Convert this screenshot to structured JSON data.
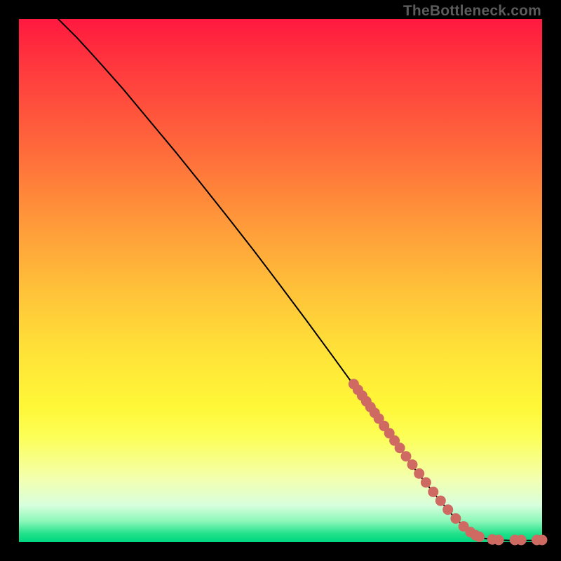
{
  "watermark": "TheBottleneck.com",
  "colors": {
    "dot_fill": "#cf6a63",
    "curve_stroke": "#000000"
  },
  "chart_data": {
    "type": "line",
    "title": "",
    "xlabel": "",
    "ylabel": "",
    "xlim": [
      0,
      100
    ],
    "ylim": [
      0,
      100
    ],
    "curve": [
      {
        "x": 7.5,
        "y": 100.0
      },
      {
        "x": 9.0,
        "y": 98.5
      },
      {
        "x": 11.0,
        "y": 96.5
      },
      {
        "x": 13.5,
        "y": 93.8
      },
      {
        "x": 16.0,
        "y": 91.0
      },
      {
        "x": 20.0,
        "y": 86.5
      },
      {
        "x": 25.0,
        "y": 80.5
      },
      {
        "x": 30.0,
        "y": 74.5
      },
      {
        "x": 35.0,
        "y": 68.3
      },
      {
        "x": 40.0,
        "y": 62.0
      },
      {
        "x": 45.0,
        "y": 55.6
      },
      {
        "x": 50.0,
        "y": 49.0
      },
      {
        "x": 55.0,
        "y": 42.3
      },
      {
        "x": 60.0,
        "y": 35.5
      },
      {
        "x": 64.0,
        "y": 30.0
      },
      {
        "x": 68.0,
        "y": 24.5
      },
      {
        "x": 72.0,
        "y": 19.0
      },
      {
        "x": 76.0,
        "y": 13.5
      },
      {
        "x": 80.0,
        "y": 8.5
      },
      {
        "x": 83.0,
        "y": 5.0
      },
      {
        "x": 85.5,
        "y": 2.6
      },
      {
        "x": 87.5,
        "y": 1.3
      },
      {
        "x": 89.0,
        "y": 0.7
      },
      {
        "x": 91.0,
        "y": 0.4
      },
      {
        "x": 94.0,
        "y": 0.3
      },
      {
        "x": 98.0,
        "y": 0.3
      },
      {
        "x": 100.0,
        "y": 0.3
      }
    ],
    "points": [
      {
        "x": 64.0,
        "y": 30.2
      },
      {
        "x": 64.8,
        "y": 29.1
      },
      {
        "x": 65.6,
        "y": 28.0
      },
      {
        "x": 66.4,
        "y": 26.9
      },
      {
        "x": 67.2,
        "y": 25.8
      },
      {
        "x": 68.0,
        "y": 24.7
      },
      {
        "x": 68.8,
        "y": 23.6
      },
      {
        "x": 69.8,
        "y": 22.2
      },
      {
        "x": 70.8,
        "y": 20.8
      },
      {
        "x": 71.8,
        "y": 19.4
      },
      {
        "x": 72.8,
        "y": 18.0
      },
      {
        "x": 74.0,
        "y": 16.4
      },
      {
        "x": 75.2,
        "y": 14.8
      },
      {
        "x": 76.5,
        "y": 13.1
      },
      {
        "x": 77.8,
        "y": 11.4
      },
      {
        "x": 79.2,
        "y": 9.6
      },
      {
        "x": 80.6,
        "y": 7.9
      },
      {
        "x": 82.0,
        "y": 6.2
      },
      {
        "x": 83.5,
        "y": 4.5
      },
      {
        "x": 85.0,
        "y": 3.0
      },
      {
        "x": 86.3,
        "y": 1.9
      },
      {
        "x": 87.3,
        "y": 1.3
      },
      {
        "x": 88.0,
        "y": 1.0
      },
      {
        "x": 90.5,
        "y": 0.5
      },
      {
        "x": 91.7,
        "y": 0.4
      },
      {
        "x": 94.8,
        "y": 0.4
      },
      {
        "x": 96.0,
        "y": 0.4
      },
      {
        "x": 99.0,
        "y": 0.4
      },
      {
        "x": 100.0,
        "y": 0.4
      }
    ]
  }
}
